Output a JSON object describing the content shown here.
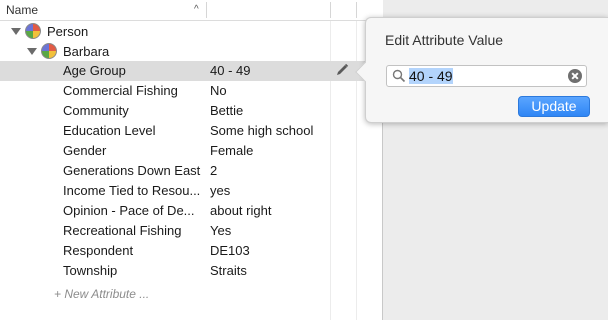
{
  "header": {
    "name_col": "Name",
    "sort_icon": "chevron-up-icon"
  },
  "tree": {
    "root": {
      "label": "Person",
      "icon": "node-icon"
    },
    "child": {
      "label": "Barbara",
      "icon": "node-icon"
    }
  },
  "attributes": [
    {
      "key": "Age Group",
      "value": "40 - 49",
      "selected": true
    },
    {
      "key": "Commercial Fishing",
      "value": "No"
    },
    {
      "key": "Community",
      "value": "Bettie"
    },
    {
      "key": "Education Level",
      "value": "Some high school"
    },
    {
      "key": "Gender",
      "value": "Female"
    },
    {
      "key": "Generations Down East",
      "value": "2"
    },
    {
      "key": "Income Tied to Resou...",
      "value": "yes"
    },
    {
      "key": "Opinion - Pace of De...",
      "value": "about right"
    },
    {
      "key": "Recreational Fishing",
      "value": "Yes"
    },
    {
      "key": "Respondent",
      "value": "DE103"
    },
    {
      "key": "Township",
      "value": "Straits"
    }
  ],
  "new_attribute_label": "+ New Attribute ...",
  "popover": {
    "title": "Edit Attribute Value",
    "search_value": "40 - 49",
    "update_label": "Update"
  },
  "colors": {
    "accent": "#2f86f5",
    "selection": "#dcdcdc",
    "text_selection": "#b3d4fc"
  }
}
